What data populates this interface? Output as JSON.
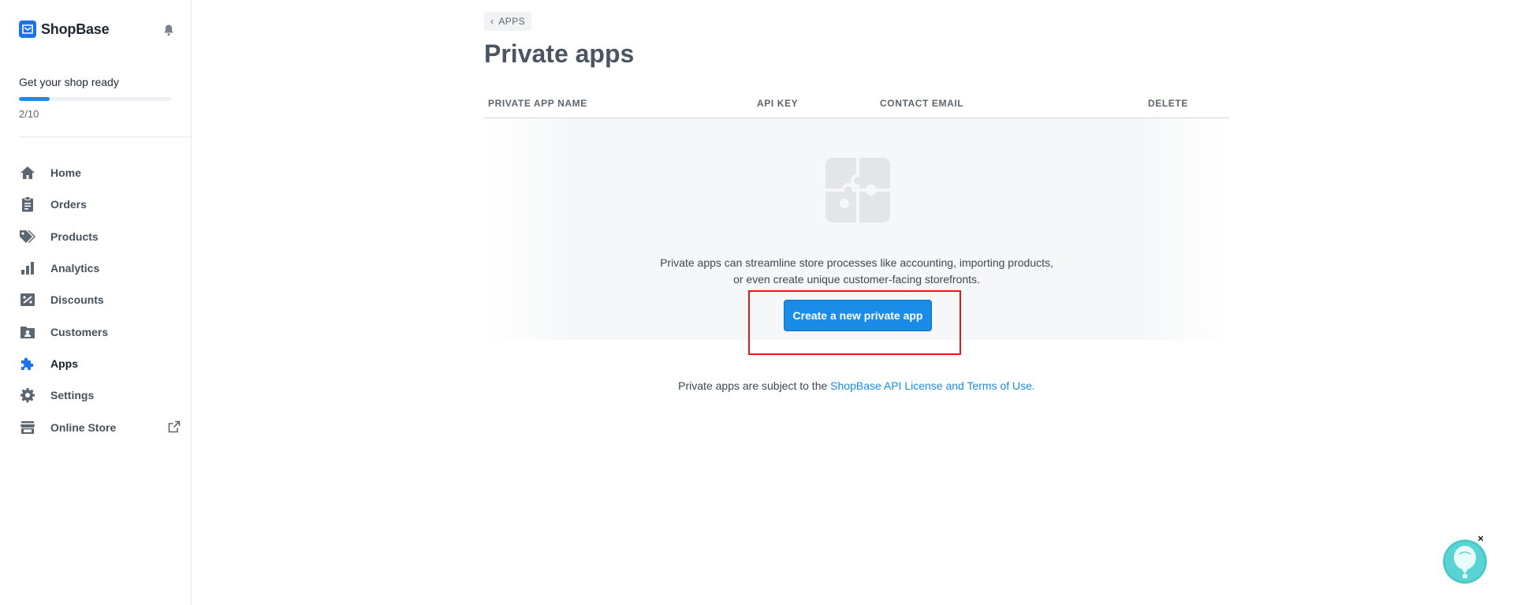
{
  "brand": {
    "name": "ShopBase"
  },
  "setup": {
    "title": "Get your shop ready",
    "progress": 0.2,
    "count_text": "2/10"
  },
  "sidebar": {
    "items": [
      {
        "label": "Home",
        "icon": "home-icon"
      },
      {
        "label": "Orders",
        "icon": "clipboard-icon"
      },
      {
        "label": "Products",
        "icon": "tag-icon"
      },
      {
        "label": "Analytics",
        "icon": "bar-chart-icon"
      },
      {
        "label": "Discounts",
        "icon": "discount-ticket-icon"
      },
      {
        "label": "Customers",
        "icon": "contact-card-icon"
      },
      {
        "label": "Apps",
        "icon": "puzzle-icon",
        "active": true
      },
      {
        "label": "Settings",
        "icon": "gear-icon"
      },
      {
        "label": "Online Store",
        "icon": "storefront-icon",
        "external": true
      }
    ]
  },
  "breadcrumb": {
    "label": "APPS"
  },
  "page": {
    "title": "Private apps"
  },
  "table": {
    "columns": [
      "PRIVATE APP NAME",
      "API KEY",
      "CONTACT EMAIL",
      "DELETE"
    ]
  },
  "empty_state": {
    "line1": "Private apps can streamline store processes like accounting, importing products,",
    "line2": "or even create unique customer-facing storefronts.",
    "button_label": "Create a new private app"
  },
  "terms": {
    "prefix": "Private apps are subject to the ",
    "link": "ShopBase API License and Terms of Use."
  },
  "help_widget": {
    "close_label": "×"
  },
  "colors": {
    "accent": "#1a8be6",
    "highlight_outline": "#e5191c",
    "icon_gray": "#5c6670",
    "active_icon": "#1a73e8"
  }
}
